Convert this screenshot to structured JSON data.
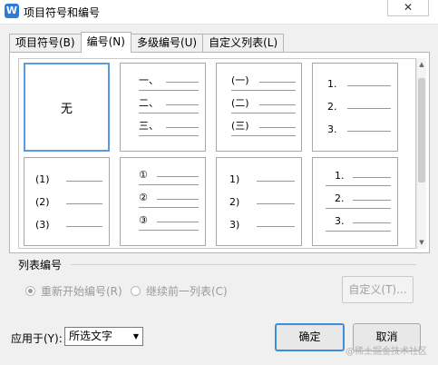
{
  "window": {
    "title": "项目符号和编号",
    "app_icon": "W",
    "close_label": "✕"
  },
  "tabs": [
    {
      "label": "项目符号(B)",
      "active": false
    },
    {
      "label": "编号(N)",
      "active": true
    },
    {
      "label": "多级编号(U)",
      "active": false
    },
    {
      "label": "自定义列表(L)",
      "active": false
    }
  ],
  "gallery": {
    "none_label": "无",
    "cells": [
      {
        "markers": []
      },
      {
        "markers": [
          "一、",
          "二、",
          "三、"
        ]
      },
      {
        "markers": [
          "(一)",
          "(二)",
          "(三)"
        ]
      },
      {
        "markers": [
          "1.",
          "2.",
          "3."
        ]
      },
      {
        "markers": [
          "(1)",
          "(2)",
          "(3)"
        ]
      },
      {
        "markers": [
          "①",
          "②",
          "③"
        ]
      },
      {
        "markers": [
          "1)",
          "2)",
          "3)"
        ]
      },
      {
        "markers": [
          "1.",
          "2.",
          "3."
        ]
      }
    ]
  },
  "list_numbering": {
    "label": "列表编号",
    "restart_label": "重新开始编号(R)",
    "continue_label": "继续前一列表(C)",
    "custom_button": "自定义(T)..."
  },
  "footer": {
    "apply_label": "应用于(Y):",
    "apply_value": "所选文字",
    "ok_label": "确定",
    "cancel_label": "取消"
  },
  "watermark": "@稀土掘金技术社区"
}
